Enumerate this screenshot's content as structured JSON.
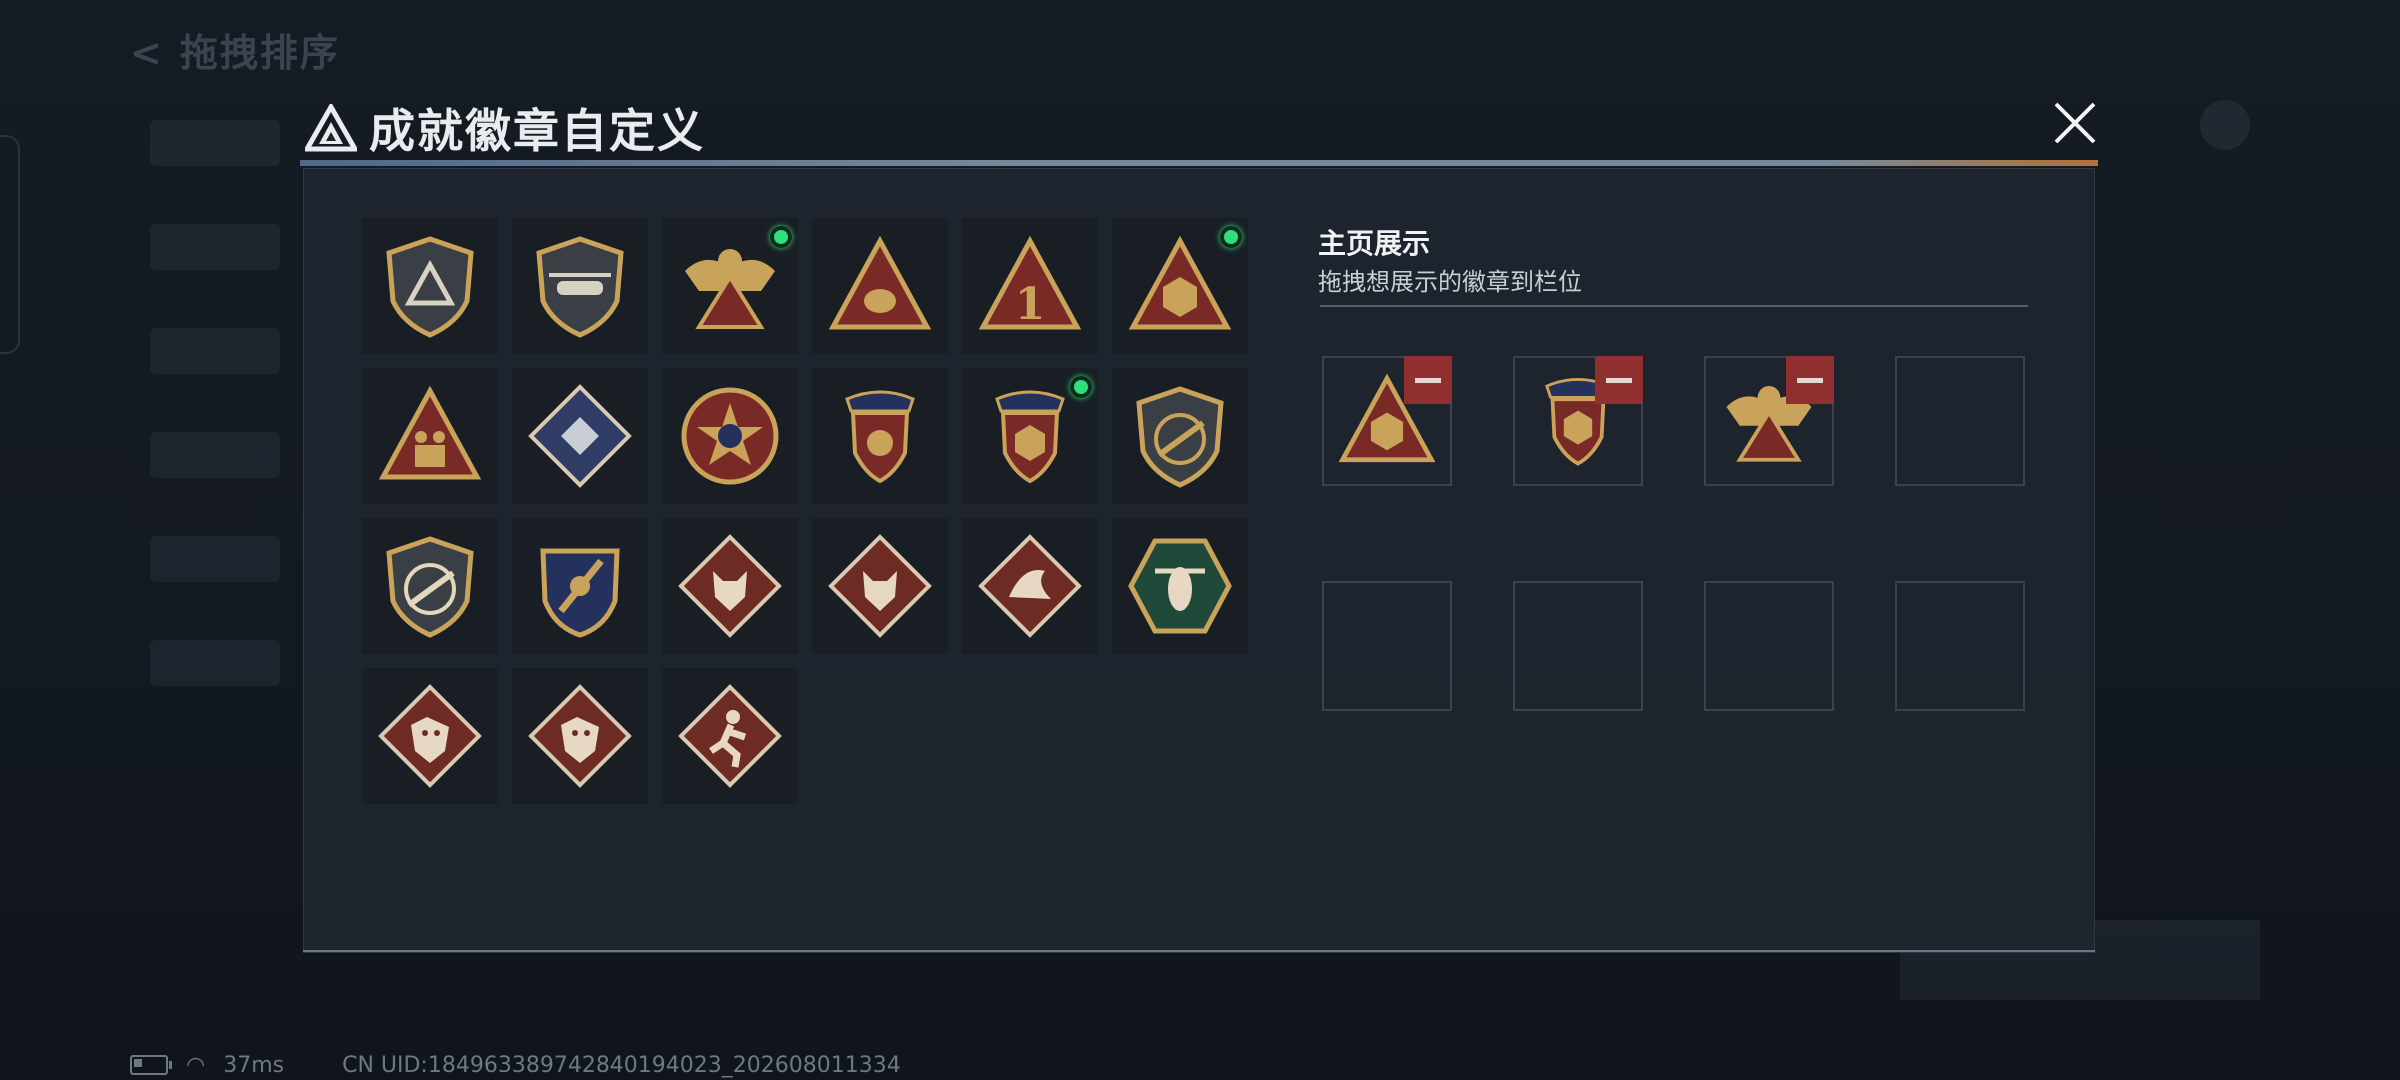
{
  "background": {
    "back_title": "拖拽排序"
  },
  "dialog": {
    "title": "成就徽章自定义",
    "close_icon": "close-icon",
    "title_icon": "triangle-logo-icon"
  },
  "badges": [
    {
      "icon": "shield-triangle-badge",
      "new": false
    },
    {
      "icon": "helicopter-shield-badge",
      "new": false
    },
    {
      "icon": "golden-eagle-badge",
      "new": true
    },
    {
      "icon": "egg-triangle-badge",
      "new": false
    },
    {
      "icon": "number-one-triangle-badge",
      "new": false
    },
    {
      "icon": "d20-triangle-badge",
      "new": true
    },
    {
      "icon": "soldiers-triangle-badge",
      "new": false
    },
    {
      "icon": "silver-diamond-badge",
      "new": false
    },
    {
      "icon": "red-star-medal-badge",
      "new": false
    },
    {
      "icon": "blue-crest-badge",
      "new": false
    },
    {
      "icon": "d20-crest-badge",
      "new": true
    },
    {
      "icon": "rifle-shield-badge",
      "new": false
    },
    {
      "icon": "rifle-shield-gold-badge",
      "new": false
    },
    {
      "icon": "sword-crest-badge",
      "new": false
    },
    {
      "icon": "wolf-diamond-badge",
      "new": false
    },
    {
      "icon": "wolf-diamond-badge-2",
      "new": false
    },
    {
      "icon": "bird-diamond-badge",
      "new": false
    },
    {
      "icon": "wasp-hexagon-badge",
      "new": false
    },
    {
      "icon": "dragon-diamond-badge",
      "new": false
    },
    {
      "icon": "dragon-diamond-badge-2",
      "new": false
    },
    {
      "icon": "runner-diamond-badge",
      "new": false
    }
  ],
  "showcase": {
    "title": "主页展示",
    "hint": "拖拽想展示的徽章到栏位",
    "slots": [
      {
        "badge": "d20-triangle-badge"
      },
      {
        "badge": "d20-crest-badge"
      },
      {
        "badge": "golden-eagle-badge"
      },
      {
        "badge": null
      },
      {
        "badge": null
      },
      {
        "badge": null
      },
      {
        "badge": null
      },
      {
        "badge": null
      }
    ]
  },
  "status_bar": {
    "ping": "37ms",
    "uid": "CN UID:184963389742840194023_202608011334"
  },
  "colors": {
    "new_dot": "#2ee07a",
    "remove_button": "#8f2f2f",
    "gold": "#c9a35a",
    "crimson": "#7a2a26",
    "navy": "#24315c"
  }
}
